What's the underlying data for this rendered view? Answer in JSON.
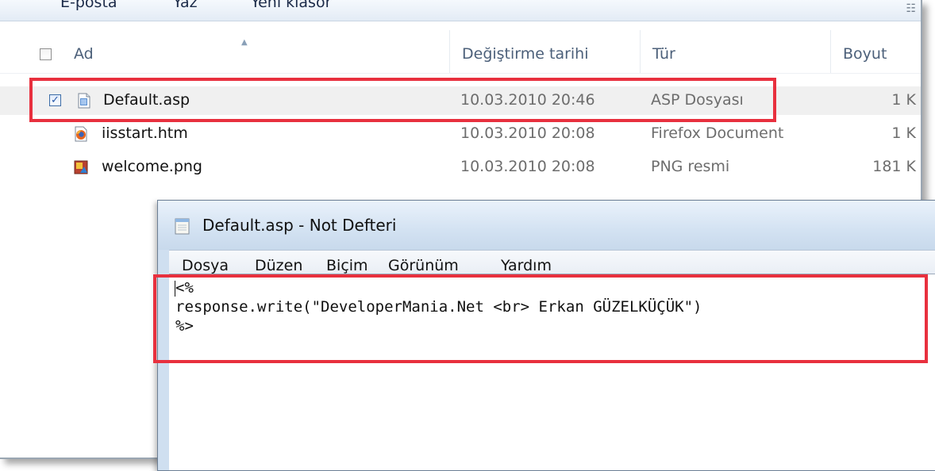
{
  "toolbar": {
    "items": [
      "E-posta",
      "Yaz",
      "Yeni klasör"
    ],
    "view_icon": "view-options-icon"
  },
  "columns": {
    "name": "Ad",
    "date": "Değiştirme tarihi",
    "type": "Tür",
    "size": "Boyut"
  },
  "files": [
    {
      "name": "Default.asp",
      "date": "10.03.2010 20:46",
      "type": "ASP Dosyası",
      "size": "1 K",
      "icon": "asp-file-icon",
      "selected": true
    },
    {
      "name": "iisstart.htm",
      "date": "10.03.2010 20:08",
      "type": "Firefox Document",
      "size": "1 K",
      "icon": "firefox-document-icon",
      "selected": false
    },
    {
      "name": "welcome.png",
      "date": "10.03.2010 20:08",
      "type": "PNG resmi",
      "size": "181 K",
      "icon": "png-image-icon",
      "selected": false
    }
  ],
  "notepad": {
    "title": "Default.asp - Not Defteri",
    "menu": [
      "Dosya",
      "Düzen",
      "Biçim",
      "Görünüm",
      "Yardım"
    ],
    "content": [
      "<%",
      "response.write(\"DeveloperMania.Net <br> Erkan GÜZELKÜÇÜK\")",
      "%>"
    ]
  },
  "colors": {
    "highlight": "#e8303e",
    "selected_row": "#f0f0f0"
  }
}
